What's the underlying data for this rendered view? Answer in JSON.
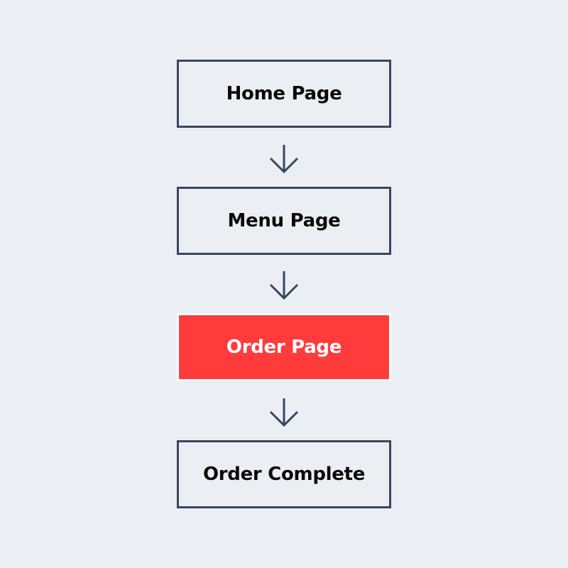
{
  "flow": {
    "steps": [
      {
        "label": "Home Page",
        "state": "default"
      },
      {
        "label": "Menu Page",
        "state": "default"
      },
      {
        "label": "Order Page",
        "state": "active"
      },
      {
        "label": "Order Complete",
        "state": "default"
      }
    ],
    "connector_icon": "arrow-down-icon"
  },
  "colors": {
    "background": "#ebeef3",
    "border": "#3a4560",
    "active_fill": "#ff3b3b",
    "active_text": "#ffffff",
    "text": "#0a0a0a"
  }
}
